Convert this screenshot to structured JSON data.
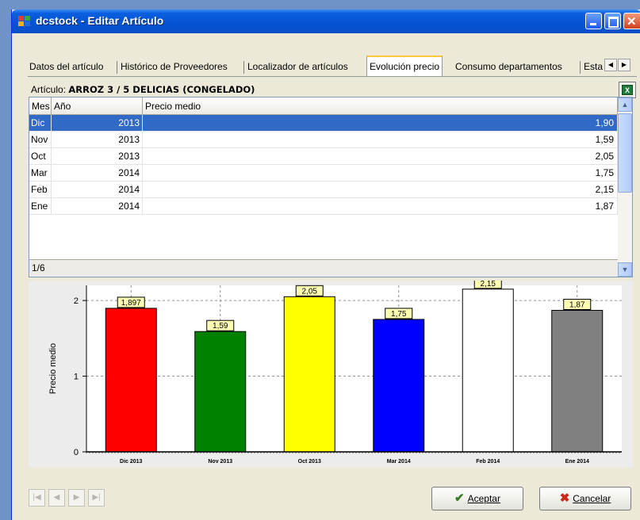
{
  "window": {
    "title": "dcstock - Editar Artículo"
  },
  "tabs": [
    "Datos del artículo",
    "Histórico de Proveedores",
    "Localizador de artículos",
    "Evolución precio",
    "Consumo departamentos",
    "Esta"
  ],
  "active_tab": "Evolución precio",
  "articulo": {
    "label": "Artículo:",
    "value": "ARROZ 3 / 5 DELICIAS (CONGELADO)"
  },
  "grid": {
    "headers": [
      "Mes",
      "Año",
      "Precio medio"
    ],
    "rows": [
      {
        "mes": "Dic",
        "anio": "2013",
        "precio": "1,90"
      },
      {
        "mes": "Nov",
        "anio": "2013",
        "precio": "1,59"
      },
      {
        "mes": "Oct",
        "anio": "2013",
        "precio": "2,05"
      },
      {
        "mes": "Mar",
        "anio": "2014",
        "precio": "1,75"
      },
      {
        "mes": "Feb",
        "anio": "2014",
        "precio": "2,15"
      },
      {
        "mes": "Ene",
        "anio": "2014",
        "precio": "1,87"
      }
    ],
    "selected_row": 0,
    "footer": "1/6"
  },
  "chart_data": {
    "type": "bar",
    "categories": [
      "Dic 2013",
      "Nov 2013",
      "Oct 2013",
      "Mar 2014",
      "Feb 2014",
      "Ene 2014"
    ],
    "values": [
      1.897,
      1.59,
      2.05,
      1.75,
      2.15,
      1.87
    ],
    "labels": [
      "1,897",
      "1,59",
      "2,05",
      "1,75",
      "2,15",
      "1,87"
    ],
    "colors": [
      "#ff0000",
      "#008000",
      "#ffff00",
      "#0000ff",
      "#ffffff",
      "#808080"
    ],
    "ylabel": "Precio medio",
    "yticks": [
      "0",
      "1",
      "2"
    ],
    "ylim": [
      0,
      2.2
    ],
    "grid": true
  },
  "buttons": {
    "aceptar": "Aceptar",
    "cancelar": "Cancelar"
  },
  "nav_buttons": [
    "first",
    "prev",
    "next",
    "last"
  ]
}
